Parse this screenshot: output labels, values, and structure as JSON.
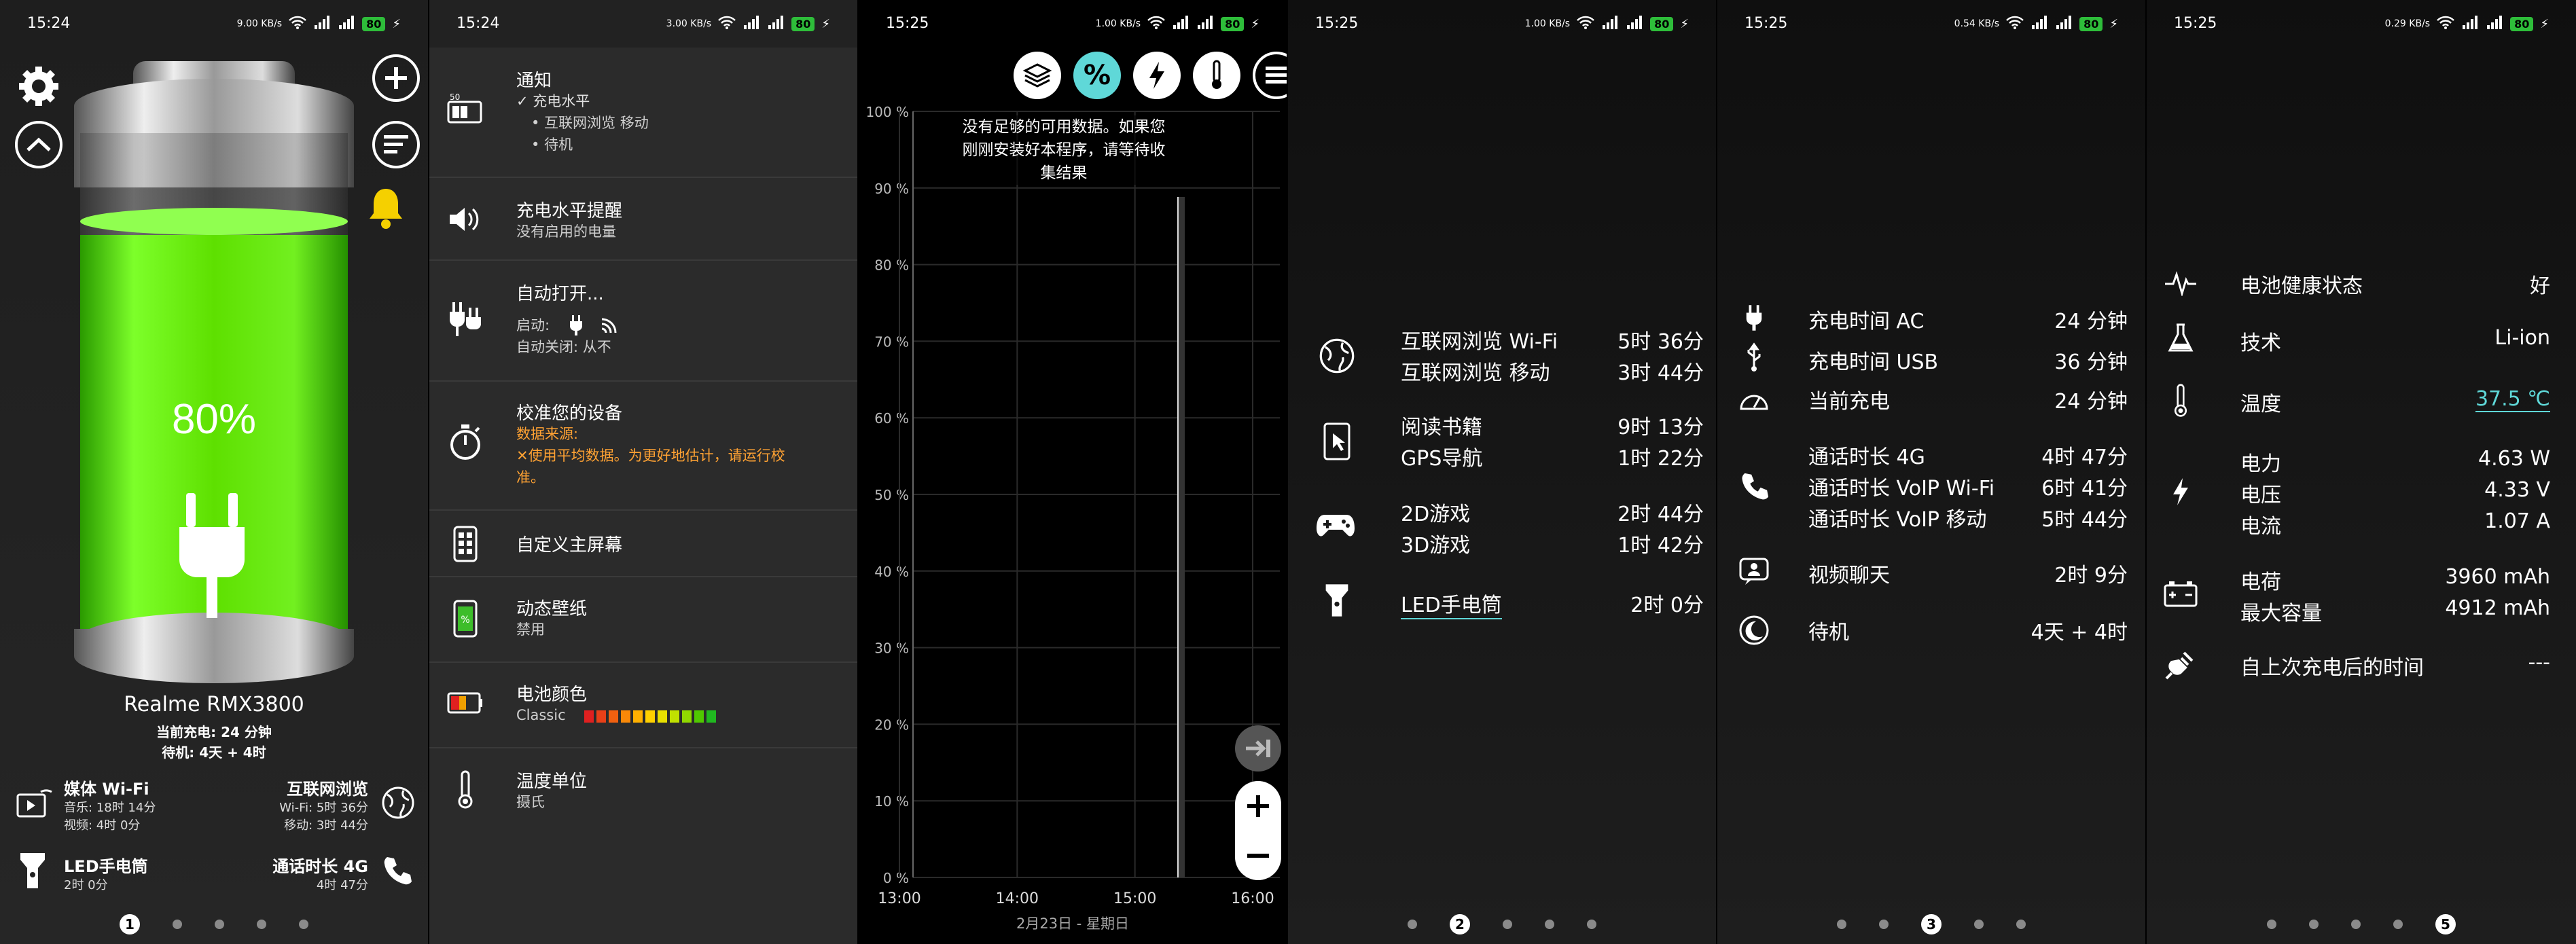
{
  "panel1": {
    "status_time": "15:24",
    "status_speed": "9.00 KB/s",
    "status_battery": "80",
    "battery_percent": "80%",
    "battery_level": 0.8,
    "device_name": "Realme RMX3800",
    "current_charge_label": "当前充电: 24 分钟",
    "standby_label": "待机: 4天 + 4时",
    "stats": [
      {
        "title": "媒体 Wi-Fi",
        "line1": "音乐: 18时 14分",
        "line2": "视频: 4时 0分"
      },
      {
        "title": "互联网浏览",
        "line1": "Wi-Fi: 5时 36分",
        "line2": "移动: 3时 44分"
      },
      {
        "title": "LED手电筒",
        "line1": "2时 0分",
        "line2": ""
      },
      {
        "title": "通话时长 4G",
        "line1": "4时 47分",
        "line2": ""
      }
    ],
    "page_index": "1"
  },
  "panel2": {
    "status_time": "15:24",
    "status_speed": "3.00 KB/s",
    "status_battery": "80",
    "settings": [
      {
        "title": "通知",
        "lines": [
          "✓ 充电水平",
          "• 互联网浏览 移动",
          "• 待机"
        ]
      },
      {
        "title": "充电水平提醒",
        "lines": [
          "没有启用的电量"
        ]
      },
      {
        "title": "自动打开...",
        "lines": [
          "启动:",
          "自动关闭: 从不"
        ]
      },
      {
        "title": "校准您的设备",
        "lines": [
          "数据来源:",
          "✕使用平均数据。为更好地估计，请运行校",
          "准。"
        ]
      },
      {
        "title": "自定义主屏幕",
        "lines": []
      },
      {
        "title": "动态壁纸",
        "lines": [
          "禁用"
        ]
      },
      {
        "title": "电池颜色",
        "lines": [
          "Classic"
        ]
      },
      {
        "title": "温度单位",
        "lines": [
          "摄氏"
        ]
      }
    ],
    "battery_icon_label": "50",
    "battery_colors": [
      "#e02020",
      "#e84018",
      "#f06010",
      "#f88808",
      "#ffb000",
      "#ffd000",
      "#e8e000",
      "#c0e000",
      "#90d800",
      "#50c800",
      "#20b820"
    ]
  },
  "panel3": {
    "status_time": "15:25",
    "status_speed": "1.00 KB/s",
    "status_battery": "80",
    "notice": "没有足够的可用数据。如果您刚刚安装好本程序，请等待收集结果",
    "y_ticks": [
      "100 %",
      "90 %",
      "80 %",
      "70 %",
      "60 %",
      "50 %",
      "40 %",
      "30 %",
      "20 %",
      "10 %",
      "0 %"
    ],
    "x_ticks": [
      "13:00",
      "14:00",
      "15:00",
      "16:00"
    ],
    "date_label": "2月23日 - 星期日",
    "top_buttons": [
      "layers-icon",
      "percent-icon",
      "bolt-icon",
      "thermometer-icon",
      "menu-icon"
    ]
  },
  "panel4": {
    "status_time": "15:25",
    "status_speed": "1.00 KB/s",
    "status_battery": "80",
    "groups": [
      {
        "icon": "globe-icon",
        "rows": [
          {
            "label": "互联网浏览 Wi-Fi",
            "value": "5时 36分"
          },
          {
            "label": "互联网浏览 移动",
            "value": "3时 44分"
          }
        ]
      },
      {
        "icon": "ebook-icon",
        "rows": [
          {
            "label": "阅读书籍",
            "value": "9时 13分"
          },
          {
            "label": "GPS导航",
            "value": "1时 22分"
          }
        ]
      },
      {
        "icon": "gamepad-icon",
        "rows": [
          {
            "label": "2D游戏",
            "value": "2时 44分"
          },
          {
            "label": "3D游戏",
            "value": "1时 42分"
          }
        ]
      },
      {
        "icon": "flashlight-icon",
        "rows": [
          {
            "label": "LED手电筒",
            "value": "2时 0分"
          }
        ]
      }
    ],
    "page_index": "2"
  },
  "panel5": {
    "status_time": "15:25",
    "status_speed": "0.54 KB/s",
    "status_battery": "80",
    "groups": [
      {
        "rows": [
          {
            "label": "充电时间 AC",
            "value": "24 分钟"
          },
          {
            "label": "充电时间 USB",
            "value": "36 分钟"
          },
          {
            "label": "当前充电",
            "value": "24 分钟"
          }
        ]
      },
      {
        "rows": [
          {
            "label": "通话时长 4G",
            "value": "4时 47分"
          },
          {
            "label": "通话时长 VoIP Wi-Fi",
            "value": "6时 41分"
          },
          {
            "label": "通话时长 VoIP 移动",
            "value": "5时 44分"
          }
        ]
      },
      {
        "rows": [
          {
            "label": "视频聊天",
            "value": "2时 9分"
          }
        ]
      },
      {
        "rows": [
          {
            "label": "待机",
            "value": "4天 + 4时"
          }
        ]
      }
    ],
    "page_index": "3"
  },
  "panel6": {
    "status_time": "15:25",
    "status_speed": "0.29 KB/s",
    "status_battery": "80",
    "rows": [
      {
        "label": "电池健康状态",
        "value": "好"
      },
      {
        "label": "技术",
        "value": "Li-ion"
      },
      {
        "label": "温度",
        "value": "37.5 ℃"
      },
      {
        "label": "电力",
        "value": "4.63 W"
      },
      {
        "label": "电压",
        "value": "4.33 V"
      },
      {
        "label": "电流",
        "value": "1.07 A"
      },
      {
        "label": "电荷",
        "value": "3960 mAh"
      },
      {
        "label": "最大容量",
        "value": "4912 mAh"
      },
      {
        "label": "自上次充电后的时间",
        "value": "---"
      }
    ],
    "page_index": "5"
  }
}
